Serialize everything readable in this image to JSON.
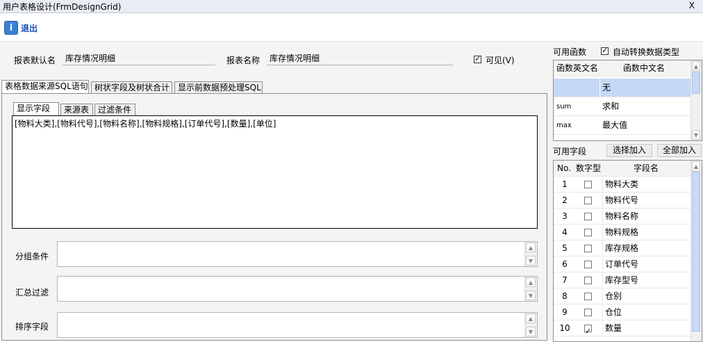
{
  "window": {
    "title": "用户表格设计(FrmDesignGrid)",
    "close": "X"
  },
  "toolbar": {
    "exit_icon_glyph": "i",
    "exit_label": "退出"
  },
  "form": {
    "default_name_label": "报表默认名",
    "default_name_value": "库存情况明细",
    "report_name_label": "报表名称",
    "report_name_value": "库存情况明细",
    "visible_label": "可见(V)",
    "visible_checked": true
  },
  "main_tabs": [
    "表格数据来源SQL语句",
    "树状字段及树状合计",
    "显示前数据预处理SQL"
  ],
  "sub_tabs": [
    "显示字段",
    "来源表",
    "过滤条件"
  ],
  "display_fields_text": "[物料大类],[物料代号],[物料名称],[物料规格],[订单代号],[数量],[单位]",
  "group_label": "分组条件",
  "summary_filter_label": "汇总过滤",
  "sort_label": "排序字段",
  "functions": {
    "label": "可用函数",
    "auto_convert_label": "自动转换数据类型",
    "auto_convert_checked": true,
    "headers": [
      "函数英文名",
      "函数中文名"
    ],
    "rows": [
      {
        "en": "",
        "cn": "无"
      },
      {
        "en": "sum",
        "cn": "求和"
      },
      {
        "en": "max",
        "cn": "最大值"
      }
    ]
  },
  "fields": {
    "label": "可用字段",
    "select_add": "选择加入",
    "add_all": "全部加入",
    "headers": [
      "No.",
      "数字型",
      "字段名"
    ],
    "rows": [
      {
        "no": "1",
        "numeric": false,
        "name": "物料大类"
      },
      {
        "no": "2",
        "numeric": false,
        "name": "物料代号"
      },
      {
        "no": "3",
        "numeric": false,
        "name": "物料名称"
      },
      {
        "no": "4",
        "numeric": false,
        "name": "物料规格"
      },
      {
        "no": "5",
        "numeric": false,
        "name": "库存规格"
      },
      {
        "no": "6",
        "numeric": false,
        "name": "订单代号"
      },
      {
        "no": "7",
        "numeric": false,
        "name": "库存型号"
      },
      {
        "no": "8",
        "numeric": false,
        "name": "仓别"
      },
      {
        "no": "9",
        "numeric": false,
        "name": "仓位"
      },
      {
        "no": "10",
        "numeric": true,
        "name": "数量"
      }
    ]
  },
  "colors": {
    "selected_row": "#c5d9f5",
    "accent": "#3b80d4"
  }
}
